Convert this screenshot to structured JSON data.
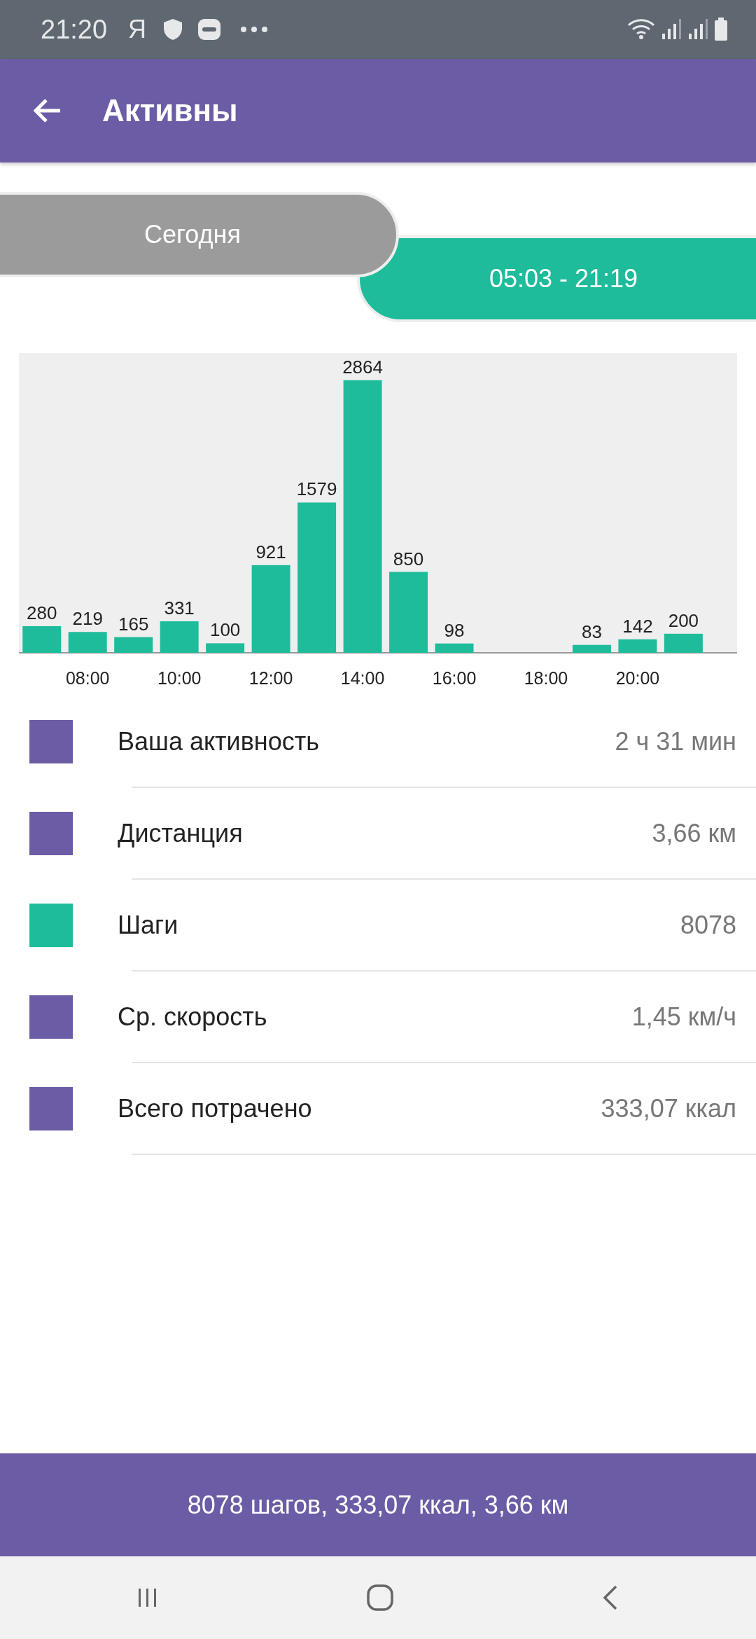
{
  "status_bar": {
    "time": "21:20",
    "carrier": "Я"
  },
  "app_bar": {
    "title": "Активны"
  },
  "period": {
    "day": "Сегодня",
    "range": "05:03 - 21:19"
  },
  "chart_data": {
    "type": "bar",
    "x": [
      7,
      8,
      9,
      10,
      11,
      12,
      13,
      14,
      15,
      16,
      17,
      18,
      19,
      20,
      21
    ],
    "series": [
      {
        "color": "#1fbc9c",
        "values": [
          280,
          219,
          165,
          331,
          100,
          921,
          1579,
          2864,
          850,
          98,
          null,
          null,
          83,
          142,
          200
        ]
      }
    ],
    "xlim": [
      6.5,
      22.17
    ],
    "ylim": [
      0,
      3150
    ],
    "xticks": [
      {
        "value": 8,
        "label": "08:00"
      },
      {
        "value": 10,
        "label": "10:00"
      },
      {
        "value": 12,
        "label": "12:00"
      },
      {
        "value": 14,
        "label": "14:00"
      },
      {
        "value": 16,
        "label": "16:00"
      },
      {
        "value": 18,
        "label": "18:00"
      },
      {
        "value": 20,
        "label": "20:00"
      }
    ],
    "data_labels": true
  },
  "stats": [
    {
      "label": "Ваша активность",
      "value": "2 ч 31 мин",
      "color": "#6b5ca5"
    },
    {
      "label": "Дистанция",
      "value": "3,66 км",
      "color": "#6b5ca5"
    },
    {
      "label": "Шаги",
      "value": "8078",
      "color": "#1fbc9c"
    },
    {
      "label": "Ср. скорость",
      "value": "1,45 км/ч",
      "color": "#6b5ca5"
    },
    {
      "label": "Всего потрачено",
      "value": "333,07 ккал",
      "color": "#6b5ca5"
    }
  ],
  "summary": "8078 шагов, 333,07 ккал, 3,66 км"
}
